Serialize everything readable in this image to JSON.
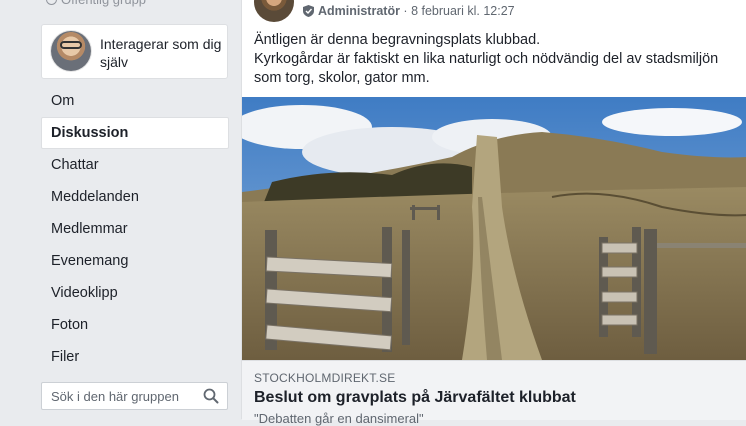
{
  "sidebar": {
    "group_type": "Offentlig grupp",
    "interact_as": "Interagerar som dig själv",
    "nav_items": [
      "Om",
      "Diskussion",
      "Chattar",
      "Meddelanden",
      "Medlemmar",
      "Evenemang",
      "Videoklipp",
      "Foton",
      "Filer"
    ],
    "active_item": "Diskussion",
    "search_placeholder": "Sök i den här gruppen"
  },
  "post": {
    "role": "Administratör",
    "timestamp": "8 februari kl. 12:27",
    "text_line1": "Äntligen är denna begravningsplats klubbad.",
    "text_line2": "Kyrkogårdar är faktiskt en lika naturligt och nödvändig del av stadsmiljön som torg, skolor, gator mm.",
    "link": {
      "domain": "STOCKHOLMDIREKT.SE",
      "title": "Beslut om gravplats på Järvafältet klubbat",
      "subtitle": "\"Debatten går en dansimeral\""
    }
  },
  "colors": {
    "page_bg": "#e9ebee",
    "card_bg": "#ffffff",
    "text_primary": "#1d2129",
    "text_secondary": "#606770"
  }
}
